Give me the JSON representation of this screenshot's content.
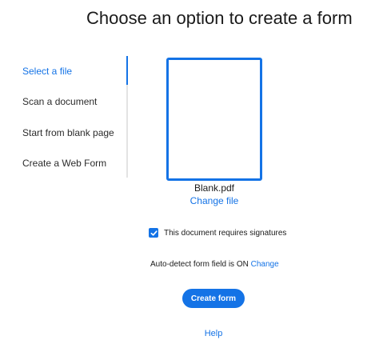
{
  "header": {
    "title": "Choose an option to create a form"
  },
  "sidebar": {
    "items": [
      {
        "label": "Select a file",
        "active": true
      },
      {
        "label": "Scan a document",
        "active": false
      },
      {
        "label": "Start from blank page",
        "active": false
      },
      {
        "label": "Create a Web Form",
        "active": false
      }
    ]
  },
  "preview": {
    "file_name": "Blank.pdf",
    "change_file_label": "Change file"
  },
  "options": {
    "signature_label": "This document requires signatures",
    "signature_checked": true,
    "autodetect_text": "Auto-detect form field is ON",
    "autodetect_change_label": "Change"
  },
  "actions": {
    "create_label": "Create form",
    "help_label": "Help"
  },
  "colors": {
    "accent": "#1473e6",
    "divider": "#e3e3e3",
    "text": "#2c2c2c"
  },
  "icons": {
    "checkbox": "checkmark-icon"
  }
}
